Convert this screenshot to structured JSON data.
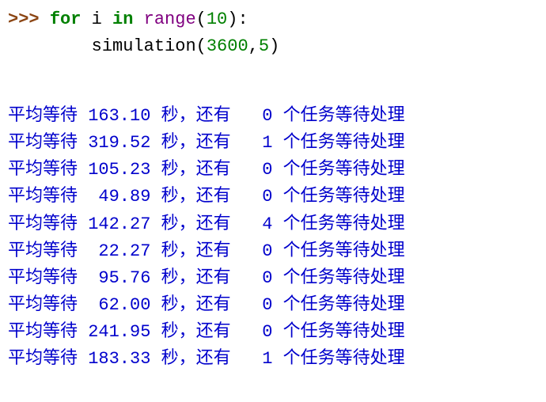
{
  "code": {
    "prompt": ">>> ",
    "for_kw": "for",
    "var": " i ",
    "in_kw": "in",
    "range_fn": " range",
    "lparen1": "(",
    "range_arg": "10",
    "rparen1": ")",
    "colon": ":",
    "indent": "        ",
    "call_fn": "simulation",
    "lparen2": "(",
    "arg1": "3600",
    "argsep": ",",
    "arg2": "5",
    "rparen2": ")"
  },
  "output": {
    "prefix": "平均等待 ",
    "mid": " 秒，还有 ",
    "suffix": " 个任务等待处理",
    "rows": [
      {
        "wait": "163.10",
        "remain": "0"
      },
      {
        "wait": "319.52",
        "remain": "1"
      },
      {
        "wait": "105.23",
        "remain": "0"
      },
      {
        "wait": " 49.89",
        "remain": "0"
      },
      {
        "wait": "142.27",
        "remain": "4"
      },
      {
        "wait": " 22.27",
        "remain": "0"
      },
      {
        "wait": " 95.76",
        "remain": "0"
      },
      {
        "wait": " 62.00",
        "remain": "0"
      },
      {
        "wait": "241.95",
        "remain": "0"
      },
      {
        "wait": "183.33",
        "remain": "1"
      }
    ]
  },
  "watermark": ""
}
